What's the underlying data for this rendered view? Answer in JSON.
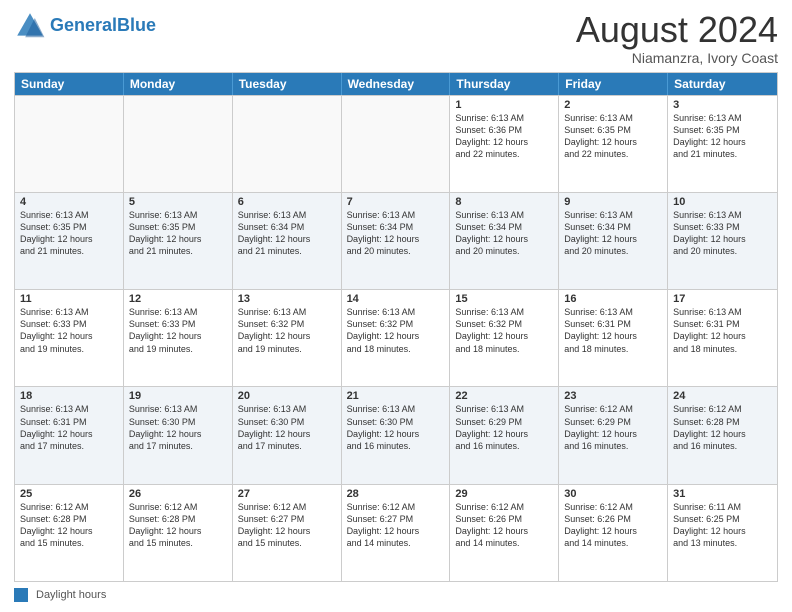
{
  "header": {
    "logo_general": "General",
    "logo_blue": "Blue",
    "main_title": "August 2024",
    "subtitle": "Niamanzra, Ivory Coast"
  },
  "days_of_week": [
    "Sunday",
    "Monday",
    "Tuesday",
    "Wednesday",
    "Thursday",
    "Friday",
    "Saturday"
  ],
  "legend_label": "Daylight hours",
  "weeks": [
    [
      {
        "day": "",
        "info": ""
      },
      {
        "day": "",
        "info": ""
      },
      {
        "day": "",
        "info": ""
      },
      {
        "day": "",
        "info": ""
      },
      {
        "day": "1",
        "info": "Sunrise: 6:13 AM\nSunset: 6:36 PM\nDaylight: 12 hours\nand 22 minutes."
      },
      {
        "day": "2",
        "info": "Sunrise: 6:13 AM\nSunset: 6:35 PM\nDaylight: 12 hours\nand 22 minutes."
      },
      {
        "day": "3",
        "info": "Sunrise: 6:13 AM\nSunset: 6:35 PM\nDaylight: 12 hours\nand 21 minutes."
      }
    ],
    [
      {
        "day": "4",
        "info": "Sunrise: 6:13 AM\nSunset: 6:35 PM\nDaylight: 12 hours\nand 21 minutes."
      },
      {
        "day": "5",
        "info": "Sunrise: 6:13 AM\nSunset: 6:35 PM\nDaylight: 12 hours\nand 21 minutes."
      },
      {
        "day": "6",
        "info": "Sunrise: 6:13 AM\nSunset: 6:34 PM\nDaylight: 12 hours\nand 21 minutes."
      },
      {
        "day": "7",
        "info": "Sunrise: 6:13 AM\nSunset: 6:34 PM\nDaylight: 12 hours\nand 20 minutes."
      },
      {
        "day": "8",
        "info": "Sunrise: 6:13 AM\nSunset: 6:34 PM\nDaylight: 12 hours\nand 20 minutes."
      },
      {
        "day": "9",
        "info": "Sunrise: 6:13 AM\nSunset: 6:34 PM\nDaylight: 12 hours\nand 20 minutes."
      },
      {
        "day": "10",
        "info": "Sunrise: 6:13 AM\nSunset: 6:33 PM\nDaylight: 12 hours\nand 20 minutes."
      }
    ],
    [
      {
        "day": "11",
        "info": "Sunrise: 6:13 AM\nSunset: 6:33 PM\nDaylight: 12 hours\nand 19 minutes."
      },
      {
        "day": "12",
        "info": "Sunrise: 6:13 AM\nSunset: 6:33 PM\nDaylight: 12 hours\nand 19 minutes."
      },
      {
        "day": "13",
        "info": "Sunrise: 6:13 AM\nSunset: 6:32 PM\nDaylight: 12 hours\nand 19 minutes."
      },
      {
        "day": "14",
        "info": "Sunrise: 6:13 AM\nSunset: 6:32 PM\nDaylight: 12 hours\nand 18 minutes."
      },
      {
        "day": "15",
        "info": "Sunrise: 6:13 AM\nSunset: 6:32 PM\nDaylight: 12 hours\nand 18 minutes."
      },
      {
        "day": "16",
        "info": "Sunrise: 6:13 AM\nSunset: 6:31 PM\nDaylight: 12 hours\nand 18 minutes."
      },
      {
        "day": "17",
        "info": "Sunrise: 6:13 AM\nSunset: 6:31 PM\nDaylight: 12 hours\nand 18 minutes."
      }
    ],
    [
      {
        "day": "18",
        "info": "Sunrise: 6:13 AM\nSunset: 6:31 PM\nDaylight: 12 hours\nand 17 minutes."
      },
      {
        "day": "19",
        "info": "Sunrise: 6:13 AM\nSunset: 6:30 PM\nDaylight: 12 hours\nand 17 minutes."
      },
      {
        "day": "20",
        "info": "Sunrise: 6:13 AM\nSunset: 6:30 PM\nDaylight: 12 hours\nand 17 minutes."
      },
      {
        "day": "21",
        "info": "Sunrise: 6:13 AM\nSunset: 6:30 PM\nDaylight: 12 hours\nand 16 minutes."
      },
      {
        "day": "22",
        "info": "Sunrise: 6:13 AM\nSunset: 6:29 PM\nDaylight: 12 hours\nand 16 minutes."
      },
      {
        "day": "23",
        "info": "Sunrise: 6:12 AM\nSunset: 6:29 PM\nDaylight: 12 hours\nand 16 minutes."
      },
      {
        "day": "24",
        "info": "Sunrise: 6:12 AM\nSunset: 6:28 PM\nDaylight: 12 hours\nand 16 minutes."
      }
    ],
    [
      {
        "day": "25",
        "info": "Sunrise: 6:12 AM\nSunset: 6:28 PM\nDaylight: 12 hours\nand 15 minutes."
      },
      {
        "day": "26",
        "info": "Sunrise: 6:12 AM\nSunset: 6:28 PM\nDaylight: 12 hours\nand 15 minutes."
      },
      {
        "day": "27",
        "info": "Sunrise: 6:12 AM\nSunset: 6:27 PM\nDaylight: 12 hours\nand 15 minutes."
      },
      {
        "day": "28",
        "info": "Sunrise: 6:12 AM\nSunset: 6:27 PM\nDaylight: 12 hours\nand 14 minutes."
      },
      {
        "day": "29",
        "info": "Sunrise: 6:12 AM\nSunset: 6:26 PM\nDaylight: 12 hours\nand 14 minutes."
      },
      {
        "day": "30",
        "info": "Sunrise: 6:12 AM\nSunset: 6:26 PM\nDaylight: 12 hours\nand 14 minutes."
      },
      {
        "day": "31",
        "info": "Sunrise: 6:11 AM\nSunset: 6:25 PM\nDaylight: 12 hours\nand 13 minutes."
      }
    ]
  ]
}
